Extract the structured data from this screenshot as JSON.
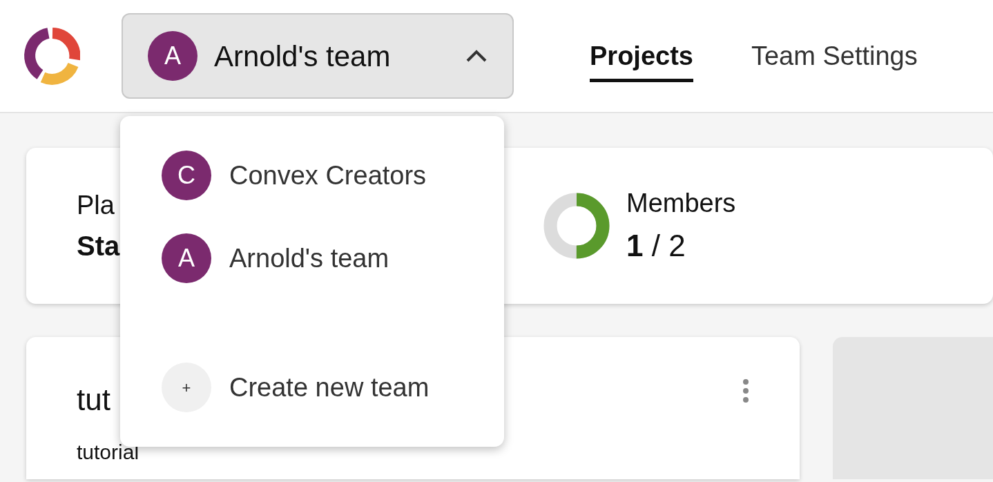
{
  "team_switcher": {
    "avatar": "A",
    "name": "Arnold's team",
    "expanded": true
  },
  "nav": [
    {
      "label": "Projects",
      "selected": true
    },
    {
      "label": "Team Settings",
      "selected": false
    }
  ],
  "plan": {
    "label": "Pla",
    "value": "Sta"
  },
  "members": {
    "label": "Members",
    "value": "**1** / 2"
  },
  "project": {
    "title": "tut",
    "subtitle": "tutorial"
  },
  "dropdown": [
    {
      "kind": "team",
      "avatar": "C",
      "name": "Convex Creators"
    },
    {
      "kind": "team",
      "avatar": "A",
      "name": "Arnold's team"
    },
    {
      "kind": "create",
      "avatar": "+",
      "name": "Create new team"
    }
  ]
}
